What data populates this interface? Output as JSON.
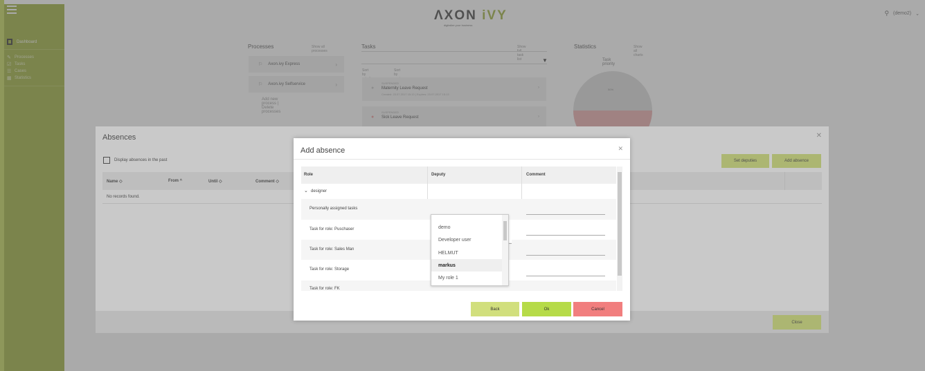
{
  "header": {
    "logo_main": "ΛXON ",
    "logo_accent": "iVY",
    "tagline": "digitalize your business",
    "user_name": "(demo2)"
  },
  "sidebar": {
    "dashboard_label": "Dashboard",
    "items": [
      {
        "label": "Processes",
        "icon": "wrench-icon"
      },
      {
        "label": "Tasks",
        "icon": "checkbox-icon"
      },
      {
        "label": "Cases",
        "icon": "list-icon"
      },
      {
        "label": "Statistics",
        "icon": "calendar-icon"
      }
    ]
  },
  "dashboard": {
    "processes_title": "Processes",
    "show_all_processes": "Show all processes",
    "processes": [
      "Axon.ivy Express",
      "Axon.ivy Selfservice"
    ],
    "process_links": "Add new process | Delete processes",
    "tasks_title": "Tasks",
    "show_full_task_list": "Show full task list",
    "sort_priority": "Sort by priority",
    "sort_expiry": "Sort by expiry time",
    "tasks": [
      {
        "state": "SUSPENDED",
        "name": "Maternity Leave Request",
        "meta": "Created: 23.07.2017 15:13 | Expires: 23.07.2017 15:13"
      },
      {
        "state": "SUSPENDED",
        "name": "Sick Leave Request",
        "meta": ""
      }
    ],
    "statistics_title": "Statistics",
    "show_all_charts": "Show all charts",
    "chart_title": "Task priority",
    "chart_label": "50%"
  },
  "absences": {
    "title": "Absences",
    "display_past": "Display absences in the past",
    "set_deputies": "Set deputies",
    "add_absence": "Add absence",
    "columns": [
      "Name",
      "From",
      "Until",
      "Comment"
    ],
    "sort_icons": [
      "◇",
      "^",
      "◇",
      "◇"
    ],
    "empty_text": "No records found.",
    "close": "Close"
  },
  "add_absence": {
    "title": "Add absence",
    "columns": [
      "Role",
      "Deputy",
      "Comment"
    ],
    "group": "designer",
    "rows": [
      "Personally assigned tasks",
      "Task for role: Puschaser",
      "Task for role: Sales Man",
      "Task for role: Storage",
      "Task for role: FK"
    ],
    "deputy_options": [
      "demo",
      "Developer user",
      "HELMUT",
      "markus",
      "My role 1"
    ],
    "selected_option": "markus",
    "back": "Back",
    "ok": "Ok",
    "cancel": "Cancel"
  }
}
